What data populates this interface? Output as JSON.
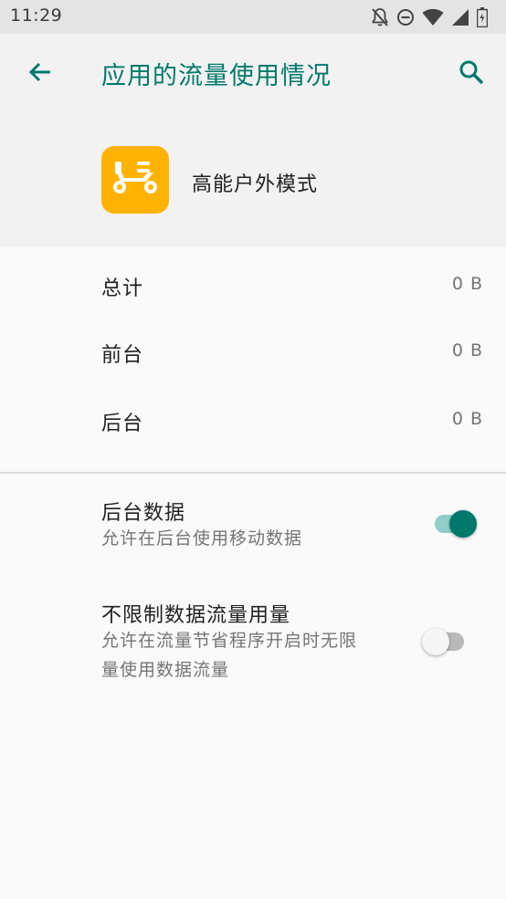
{
  "status_bar": {
    "time": "11:29",
    "icons": [
      "notifications-off-icon",
      "do-not-disturb-icon",
      "wifi-icon",
      "signal-icon",
      "battery-icon"
    ]
  },
  "toolbar": {
    "title": "应用的流量使用情况",
    "back_icon": "arrow-back-icon",
    "search_icon": "search-icon",
    "accent_color": "#00796b"
  },
  "app": {
    "name": "高能户外模式",
    "icon": "scooter-icon",
    "icon_color": "#ffb300"
  },
  "usage": [
    {
      "label": "总计",
      "value": "0 B"
    },
    {
      "label": "前台",
      "value": "0 B"
    },
    {
      "label": "后台",
      "value": "0 B"
    }
  ],
  "preferences": [
    {
      "title": "后台数据",
      "summary": "允许在后台使用移动数据",
      "enabled": true
    },
    {
      "title": "不限制数据流量用量",
      "summary_line1": "允许在流量节省程序开启时无限",
      "summary_line2": "量使用数据流量",
      "enabled": false
    }
  ]
}
